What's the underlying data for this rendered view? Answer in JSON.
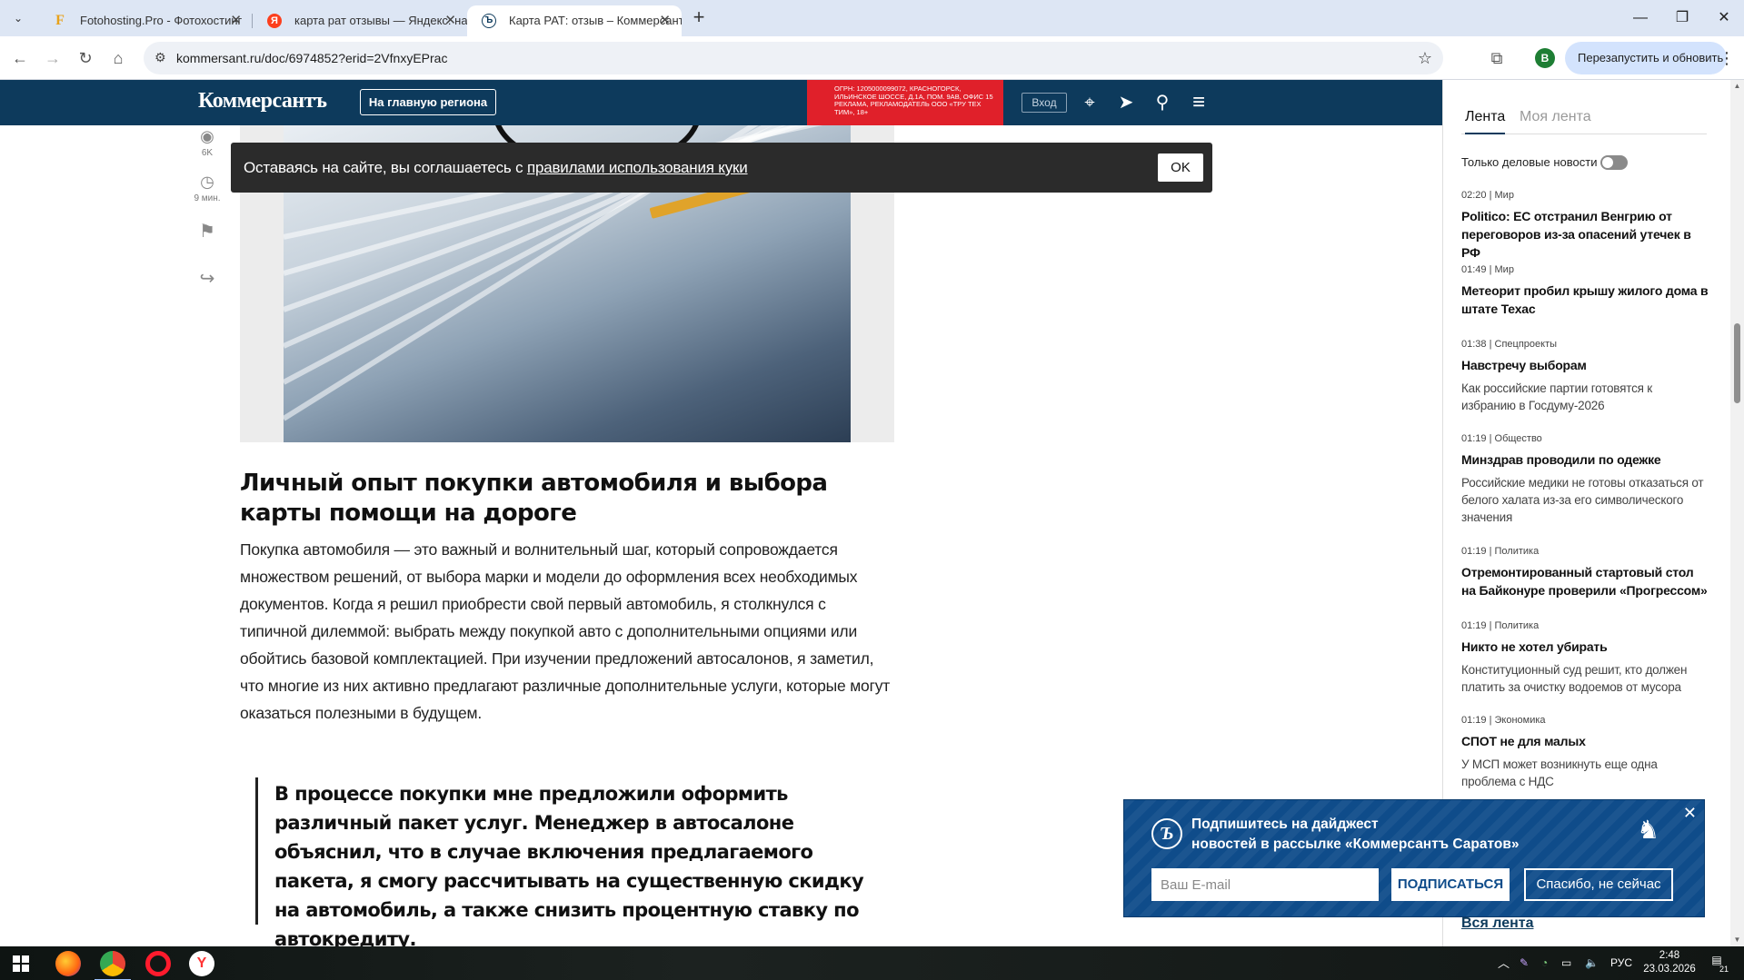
{
  "browser": {
    "tabs": [
      {
        "title": "Fotohosting.Pro - Фотохостинг",
        "favicon": "F",
        "favicon_color": "#e8a21b",
        "active": false
      },
      {
        "title": "карта рат отзывы — Яндекс: на",
        "favicon": "Я",
        "favicon_color": "#fc3f1d",
        "active": false
      },
      {
        "title": "Карта РАТ: отзыв – Коммерсант",
        "favicon": "Ъ",
        "favicon_color": "#0d3a5c",
        "active": true
      }
    ],
    "url": "kommersant.ru/doc/6974852?erid=2VfnxyEPrac",
    "profile_initial": "В",
    "restart_label": "Перезапустить и обновить"
  },
  "site_header": {
    "logo": "Коммерсантъ",
    "region_button": "На главную региона",
    "ad_text": "ОГРН: 1205000099072, Красногорск, Ильинское шоссе, д.1а, пом. 9АВ, офис 15 Реклама, рекламодатель ООО «Тру Тех Тим», 18+",
    "login": "Вход"
  },
  "article_tools": {
    "views": "6K",
    "read_time": "9 мин."
  },
  "cookie_banner": {
    "text_before": "Оставаясь на сайте, вы соглашаетесь с ",
    "link": "правилами использования куки",
    "ok": "OK"
  },
  "article": {
    "heading": "Личный опыт покупки автомобиля и выбора карты помощи на дороге",
    "paragraph": "Покупка автомобиля — это важный и волнительный шаг, который сопровождается множеством решений, от выбора марки и модели до оформления всех необходимых документов. Когда я решил приобрести свой первый автомобиль, я столкнулся с типичной дилеммой: выбрать между покупкой авто с дополнительными опциями или обойтись базовой комплектацией. При изучении предложений автосалонов, я заметил, что многие из них активно предлагают различные дополнительные услуги, которые могут оказаться полезными в будущем.",
    "quote": "В процессе покупки мне предложили оформить различный пакет услуг. Менеджер в автосалоне объяснил, что в случае включения предлагаемого пакета, я смогу рассчитывать на существенную скидку на автомобиль, а также снизить процентную ставку по автокредиту."
  },
  "feed": {
    "tab_active": "Лента",
    "tab_inactive": "Моя лента",
    "toggle_label": "Только деловые новости",
    "toggle_on": false,
    "items": [
      {
        "time": "02:20",
        "rubric": "Мир",
        "title": "Politico: ЕС отстранил Венгрию от переговоров из-за опасений утечек в РФ",
        "subtitle": ""
      },
      {
        "time": "01:49",
        "rubric": "Мир",
        "title": "Метеорит пробил крышу жилого дома в штате Техас",
        "subtitle": ""
      },
      {
        "time": "01:38",
        "rubric": "Спецпроекты",
        "title": "Навстречу выборам",
        "subtitle": "Как российские партии готовятся к избранию в Госдуму-2026"
      },
      {
        "time": "01:19",
        "rubric": "Общество",
        "title": "Минздрав проводили по одежке",
        "subtitle": "Российские медики не готовы отказаться от белого халата из-за его символического значения"
      },
      {
        "time": "01:19",
        "rubric": "Политика",
        "title": "Отремонтированный стартовый стол на Байконуре проверили «Прогрессом»",
        "subtitle": ""
      },
      {
        "time": "01:19",
        "rubric": "Политика",
        "title": "Никто не хотел убирать",
        "subtitle": "Конституционный суд решит, кто должен платить за очистку водоемов от мусора"
      },
      {
        "time": "01:19",
        "rubric": "Экономика",
        "title": "СПОТ не для малых",
        "subtitle": "У МСП может возникнуть еще одна проблема с НДС"
      }
    ],
    "all_link": "Вся лента"
  },
  "subscribe": {
    "line1": "Подпишитесь на дайджест",
    "line2": "новостей в рассылке «Коммерсантъ Саратов»",
    "email_placeholder": "Ваш E-mail",
    "subscribe_button": "ПОДПИСАТЬСЯ",
    "decline_button": "Спасибо, не сейчас"
  },
  "taskbar": {
    "language": "РУС",
    "time": "2:48",
    "date": "23.03.2026",
    "notifications": "21"
  },
  "colors": {
    "brand_navy": "#0d3a5c",
    "ad_red": "#e0202a",
    "subscribe_blue": "#0f4c8a"
  }
}
